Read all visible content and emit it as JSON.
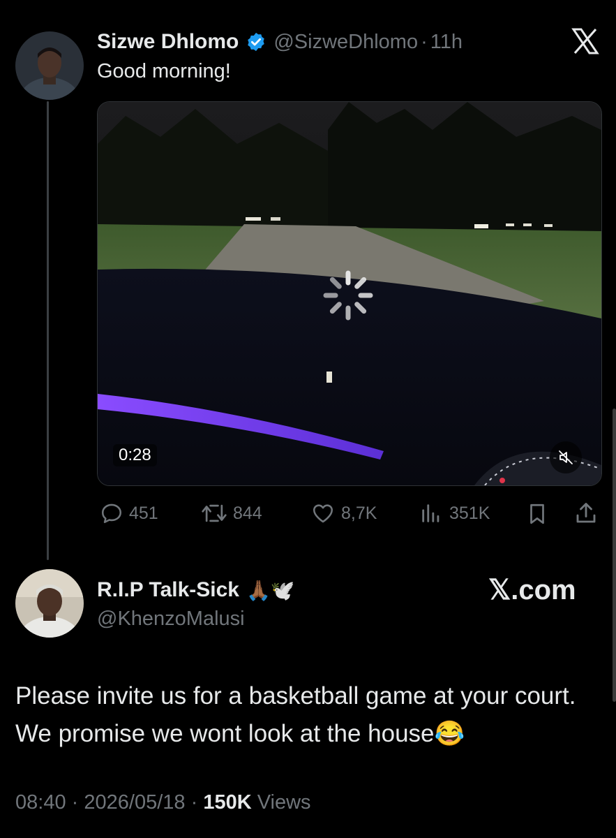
{
  "tweet": {
    "author_name": "Sizwe Dhlomo",
    "handle": "@SizweDhlomo",
    "separator": "·",
    "time": "11h",
    "text": "Good morning!",
    "video_duration": "0:28",
    "metrics": {
      "replies": "451",
      "reposts": "844",
      "likes": "8,7K",
      "views": "351K"
    }
  },
  "quote": {
    "author_name": "R.I.P Talk-Sick",
    "name_emoji": "🙏🏾🕊️",
    "handle": "@KhenzoMalusi",
    "brand": "𝕏.com",
    "text": "Please invite us for a basketball game at your court. We promise we wont look at the house😂"
  },
  "footer": {
    "time": "08:40",
    "sep1": "·",
    "date": "2026/05/18",
    "sep2": "·",
    "views_count": "150K",
    "views_label": "Views"
  },
  "colors": {
    "background": "#000000",
    "verified": "#1d9bf0",
    "muted": "#71767b",
    "text": "#e7e9ea"
  },
  "icons": {
    "close": "x-logo-icon",
    "verified": "verified-badge-icon",
    "reply": "reply-icon",
    "repost": "repost-icon",
    "like": "heart-icon",
    "views": "views-icon",
    "bookmark": "bookmark-icon",
    "share": "share-icon",
    "mute": "mute-icon",
    "loading": "loading-spinner-icon"
  }
}
